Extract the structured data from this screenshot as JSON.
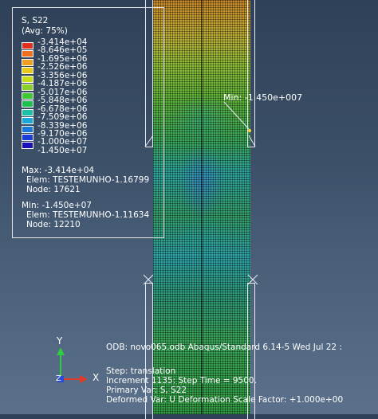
{
  "legend": {
    "variable": "S, S22",
    "averaging": "(Avg: 75%)",
    "entries": [
      {
        "value": "-3.414e+04",
        "color": "#e0301e"
      },
      {
        "value": "-8.646e+05",
        "color": "#f07020"
      },
      {
        "value": "-1.695e+06",
        "color": "#f0a020"
      },
      {
        "value": "-2.526e+06",
        "color": "#e8c81e"
      },
      {
        "value": "-3.356e+06",
        "color": "#c8dc1a"
      },
      {
        "value": "-4.187e+06",
        "color": "#8ad02a"
      },
      {
        "value": "-5.017e+06",
        "color": "#3ec832"
      },
      {
        "value": "-5.848e+06",
        "color": "#20c050"
      },
      {
        "value": "-6.678e+06",
        "color": "#1ebea8"
      },
      {
        "value": "-7.509e+06",
        "color": "#1aa8d8"
      },
      {
        "value": "-8.339e+06",
        "color": "#1a78d8"
      },
      {
        "value": "-9.170e+06",
        "color": "#1a3cd8"
      },
      {
        "value": "-1.000e+07",
        "color": "#1a10b8"
      },
      {
        "value": "-1.450e+07",
        "color": "#1a10b8"
      }
    ],
    "max": {
      "label": "Max: -3.414e+04",
      "elem": "Elem: TESTEMUNHO-1.16799",
      "node": "Node: 17621"
    },
    "min": {
      "label": "Min: -1.450e+07",
      "elem": "Elem: TESTEMUNHO-1.11634",
      "node": "Node: 12210"
    }
  },
  "min_marker": "Min: -1.450e+007",
  "triad": {
    "y": "Y",
    "z": "Z",
    "x": "X"
  },
  "info": {
    "odb": "ODB: novo065.odb    Abaqus/Standard 6.14-5    Wed Jul 22 :",
    "step": "Step: translation",
    "increment": "Increment   1135: Step Time =      9500.",
    "primary": "Primary Var: S, S22",
    "deformed": "Deformed Var: U   Deformation Scale Factor: +1.000e+00"
  }
}
